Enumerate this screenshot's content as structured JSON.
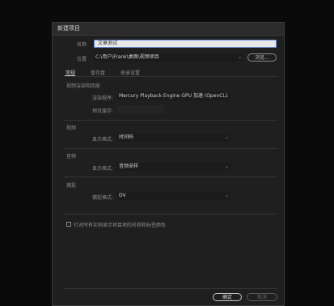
{
  "dialog": {
    "title": "新建项目",
    "name_label": "名称",
    "name_value": "文章测试",
    "location_label": "位置",
    "location_value": "C:\\用户\\Frank\\桌面\\视频项目",
    "browse_button": "浏览..."
  },
  "tabs": [
    {
      "label": "常规",
      "active": true
    },
    {
      "label": "暂存盘",
      "active": false
    },
    {
      "label": "收录设置",
      "active": false
    }
  ],
  "sections": {
    "render": {
      "title": "视频渲染和回放",
      "renderer_label": "渲染程序:",
      "renderer_value": "Mercury Playback Engine GPU 加速 (OpenCL)",
      "preview_cache_label": "预览缓存:"
    },
    "video": {
      "title": "视频",
      "display_format_label": "显示格式:",
      "display_format_value": "时间码"
    },
    "audio": {
      "title": "音频",
      "display_format_label": "显示格式:",
      "display_format_value": "音频采样"
    },
    "capture": {
      "title": "捕捉",
      "capture_format_label": "捕捉格式:",
      "capture_format_value": "DV"
    }
  },
  "checkbox_label": "针对所有实例显示项目项的名称和标签颜色",
  "footer": {
    "ok_button": "确定",
    "cancel_button": "取消"
  }
}
